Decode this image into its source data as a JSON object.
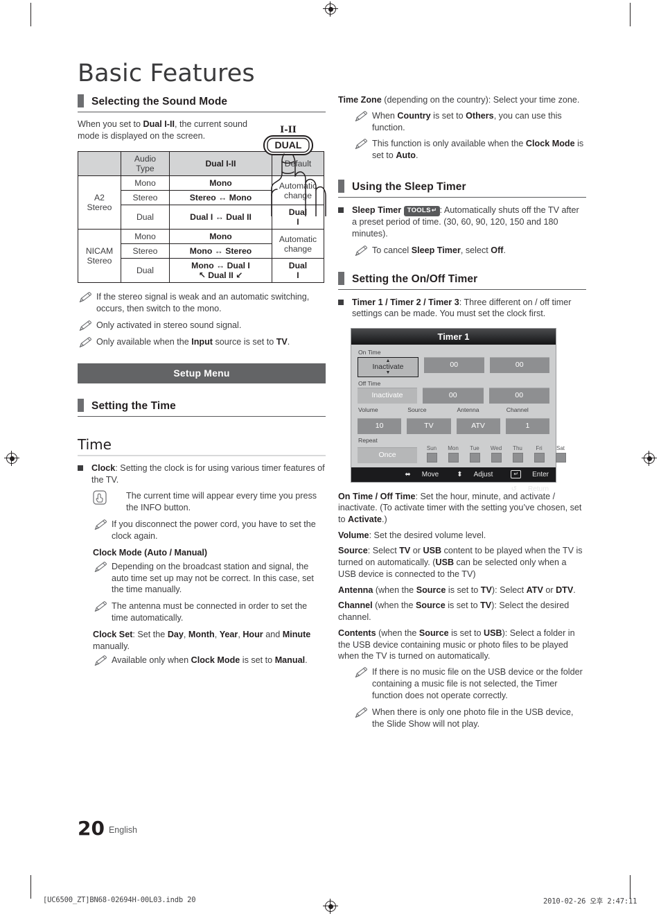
{
  "document": {
    "chapter_title": "Basic Features",
    "page_number": "20",
    "language": "English",
    "footer_left": "[UC6500_ZT]BN68-02694H-00L03.indb   20",
    "footer_right": "2010-02-26   오후 2:47:11"
  },
  "left_column": {
    "section_sound_mode": {
      "heading": "Selecting the Sound Mode",
      "intro_html": "When you set to <b>Dual I-II</b>, the current sound mode is displayed on the screen.",
      "remote_button": {
        "label": "DUAL",
        "top_label": "I-II"
      }
    },
    "audio_table": {
      "headers": [
        "",
        "Audio Type",
        "Dual I-II",
        "Default"
      ],
      "rows": [
        {
          "group": "A2 Stereo",
          "group_rowspan": 3,
          "type": "Mono",
          "dual": "Mono",
          "default": "Automatic change",
          "default_rowspan": 2,
          "dual_bold": true,
          "default_bold": false
        },
        {
          "type": "Stereo",
          "dual": "Stereo ↔ Mono",
          "dual_bold": true
        },
        {
          "type": "Dual",
          "dual": "Dual I ↔ Dual II",
          "default": "Dual I",
          "dual_bold": true,
          "default_bold": true
        },
        {
          "group": "NICAM Stereo",
          "group_rowspan": 3,
          "type": "Mono",
          "dual": "Mono",
          "default": "Automatic change",
          "default_rowspan": 2,
          "dual_bold": true,
          "default_bold": false
        },
        {
          "type": "Stereo",
          "dual": "Mono ↔ Stereo",
          "dual_bold": true
        },
        {
          "type": "Dual",
          "dual": "Mono ↔ Dual I",
          "dual_line2": "↖ Dual II ↙",
          "default": "Dual I",
          "dual_bold": true,
          "default_bold": true
        }
      ]
    },
    "sound_notes": [
      "If the stereo signal is weak and an automatic switching, occurs, then switch to the mono.",
      "Only activated in stereo sound signal.",
      "Only available when the <b>Input</b> source is set to <b>TV</b>."
    ],
    "setup_menu_banner": "Setup Menu",
    "section_setting_time": {
      "heading": "Setting the Time"
    },
    "time_subhead": "Time",
    "clock_bullet": "<b>Clock</b>: Setting the clock is for using various timer features of the TV.",
    "clock_hand_note": "The current time will appear every time you press the INFO button.",
    "clock_note_1": "If you disconnect the power cord, you have to set the clock again.",
    "clock_mode_heading": "Clock Mode (Auto / Manual)",
    "clock_mode_notes": [
      "Depending on the broadcast station and signal, the auto time set up may not be correct. In this case, set the time manually.",
      "The antenna must be connected in order to set the time automatically."
    ],
    "clock_set_text": "<b>Clock Set</b>: Set the <b>Day</b>, <b>Month</b>, <b>Year</b>, <b>Hour</b> and <b>Minute</b> manually.",
    "clock_set_note": "Available only when <b>Clock Mode</b> is set to <b>Manual</b>."
  },
  "right_column": {
    "time_zone_text": "<b>Time Zone</b> (depending on the country): Select your time zone.",
    "time_zone_notes": [
      "When <b>Country</b> is set to <b>Others</b>, you can use this function.",
      "This function is only available when the <b>Clock Mode</b> is set to <b>Auto</b>."
    ],
    "section_sleep_timer": {
      "heading": "Using the Sleep Timer"
    },
    "sleep_timer_bullet_pre": "Sleep Timer",
    "sleep_timer_badge": "TOOLS",
    "sleep_timer_bullet_post": ": Automatically shuts off the TV after a preset period of time. (30, 60, 90, 120, 150 and 180 minutes).",
    "sleep_timer_note": "To cancel <b>Sleep Timer</b>, select <b>Off</b>.",
    "section_onoff_timer": {
      "heading": "Setting the On/Off Timer"
    },
    "timer_bullet": "<b>Timer 1 / Timer 2 / Timer 3</b>: Three different on / off timer settings can be made. You must set the clock first.",
    "osd": {
      "title": "Timer 1",
      "on_time_label": "On Time",
      "on_time_mode": "Inactivate",
      "on_time_hour": "00",
      "on_time_minute": "00",
      "off_time_label": "Off Time",
      "off_time_mode": "Inactivate",
      "off_time_hour": "00",
      "off_time_minute": "00",
      "volume_label": "Volume",
      "volume_value": "10",
      "source_label": "Source",
      "source_value": "TV",
      "antenna_label": "Antenna",
      "antenna_value": "ATV",
      "channel_label": "Channel",
      "channel_value": "1",
      "repeat_label": "Repeat",
      "repeat_value": "Once",
      "days": [
        "Sun",
        "Mon",
        "Tue",
        "Wed",
        "Thu",
        "Fri",
        "Sat"
      ],
      "footer": [
        {
          "glyph": "move",
          "label": "Move"
        },
        {
          "glyph": "adjust",
          "label": "Adjust"
        },
        {
          "glyph": "enter",
          "label": "Enter"
        },
        {
          "glyph": "return",
          "label": "Return"
        }
      ]
    },
    "descriptions": [
      "<b>On Time / Off Time</b>: Set the hour, minute, and activate / inactivate. (To activate timer with the setting you’ve chosen, set to <b>Activate</b>.)",
      "<b>Volume</b>: Set the desired volume level.",
      "<b>Source</b>: Select <b>TV</b> or <b>USB</b> content to be played when the TV is turned on automatically. (<b>USB</b> can be selected only when a USB device is connected to the TV)",
      "<b>Antenna</b> (when the <b>Source</b> is set to <b>TV</b>): Select <b>ATV</b> or <b>DTV</b>.",
      "<b>Channel</b> (when the <b>Source</b> is set to <b>TV</b>): Select the desired channel.",
      "<b>Contents</b> (when the <b>Source</b> is set to <b>USB</b>): Select a folder in the USB device containing music or photo files to be played when the TV is turned on automatically."
    ],
    "contents_notes": [
      "If there is no music file on the USB device or the folder containing a music file is not selected, the Timer function does not operate correctly.",
      "When there is only one photo file in the USB device, the Slide Show will not play."
    ]
  },
  "colors": {
    "heading_bar": "#6d6e71",
    "banner_bg": "#636466",
    "table_header_bg": "#d3d4d5",
    "osd_title_bg": "#2c2d2f",
    "osd_body_bg": "#cdcecf",
    "osd_field_bg": "#8e8f91"
  }
}
